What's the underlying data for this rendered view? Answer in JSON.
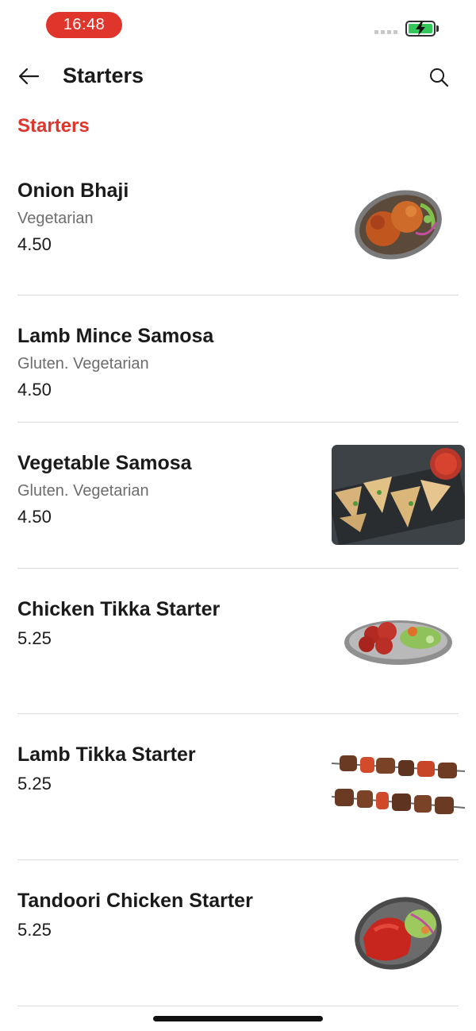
{
  "status_bar": {
    "time": "16:48",
    "battery_color": "#34c759",
    "time_pill_color": "#e0352b"
  },
  "nav": {
    "title": "Starters",
    "back_icon": "arrow-left-icon",
    "search_icon": "search-icon"
  },
  "section": {
    "title": "Starters",
    "accent_color": "#e0352b"
  },
  "items": [
    {
      "name": "Onion Bhaji",
      "tags": "Vegetarian",
      "price": "4.50",
      "image": "onion-bhaji-dish"
    },
    {
      "name": "Lamb Mince Samosa",
      "tags": "Gluten. Vegetarian",
      "price": "4.50",
      "image": ""
    },
    {
      "name": "Vegetable Samosa",
      "tags": "Gluten. Vegetarian",
      "price": "4.50",
      "image": "vegetable-samosa-dish"
    },
    {
      "name": "Chicken Tikka Starter",
      "tags": "",
      "price": "5.25",
      "image": "chicken-tikka-dish"
    },
    {
      "name": "Lamb Tikka Starter",
      "tags": "",
      "price": "5.25",
      "image": "lamb-tikka-skewers"
    },
    {
      "name": "Tandoori Chicken Starter",
      "tags": "",
      "price": "5.25",
      "image": "tandoori-chicken-dish"
    }
  ]
}
